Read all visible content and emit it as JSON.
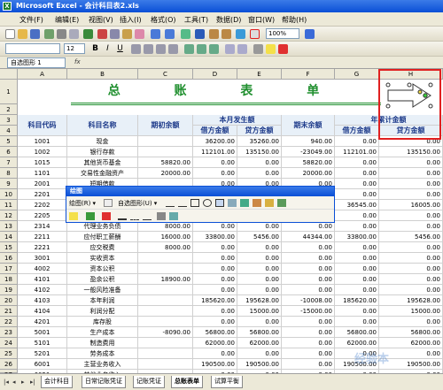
{
  "window": {
    "title": "Microsoft Excel - 会计科目表2.xls",
    "app_icon": "X"
  },
  "menu": [
    "文件(F)",
    "编辑(E)",
    "视图(V)",
    "插入(I)",
    "格式(O)",
    "工具(T)",
    "数据(D)",
    "窗口(W)",
    "帮助(H)"
  ],
  "toolbar": {
    "zoom": "100%",
    "font_size": "12"
  },
  "namebox": {
    "value": "自选图形 1",
    "fx": "fx"
  },
  "columns": [
    "A",
    "B",
    "C",
    "D",
    "E",
    "F",
    "G",
    "H"
  ],
  "rows": [
    "1",
    "2",
    "3",
    "4",
    "5",
    "6",
    "7",
    "8",
    "9",
    "10",
    "11",
    "12",
    "13",
    "14",
    "15",
    "16",
    "17",
    "18",
    "19",
    "20",
    "21",
    "22",
    "23",
    "24",
    "25",
    "26",
    "27"
  ],
  "sheet": {
    "title": "总 账 表 单",
    "headers": {
      "code": "科目代码",
      "name": "科目名称",
      "opening": "期初余额",
      "current_period": "本月发生额",
      "debit": "借方金额",
      "credit": "贷方金额",
      "closing": "期末余额",
      "ytd": "年累计金额",
      "ytd_debit": "借方金额",
      "ytd_credit": "贷方金额"
    },
    "data": [
      [
        "1001",
        "现金",
        "",
        "36200.00",
        "35260.00",
        "940.00",
        "0.00",
        "0.00"
      ],
      [
        "1002",
        "银行存款",
        "",
        "112101.00",
        "135150.00",
        "-23049.00",
        "112101.00",
        "135150.00"
      ],
      [
        "1015",
        "其他货币基金",
        "58820.00",
        "0.00",
        "0.00",
        "58820.00",
        "0.00",
        "0.00"
      ],
      [
        "1101",
        "交易性金融资产",
        "20000.00",
        "0.00",
        "0.00",
        "20000.00",
        "0.00",
        "0.00"
      ],
      [
        "2001",
        "短期借款",
        "",
        "0.00",
        "0.00",
        "0.00",
        "0.00",
        "0.00"
      ],
      [
        "2201",
        "应付票据",
        "",
        "0.00",
        "0.00",
        "0.00",
        "0.00",
        "0.00"
      ],
      [
        "2202",
        "应付账款",
        "",
        "0.00",
        "0.00",
        "0.00",
        "36545.00",
        "16005.00"
      ],
      [
        "2205",
        "预收账款",
        "",
        "0.00",
        "0.00",
        "0.00",
        "0.00",
        "0.00"
      ],
      [
        "2314",
        "代理业务负债",
        "8000.00",
        "0.00",
        "0.00",
        "0.00",
        "0.00",
        "0.00"
      ],
      [
        "2211",
        "应付职工薪酬",
        "16000.00",
        "33800.00",
        "5456.00",
        "44344.00",
        "33800.00",
        "5456.00"
      ],
      [
        "2221",
        "应交税费",
        "8000.00",
        "0.00",
        "0.00",
        "0.00",
        "0.00",
        "0.00"
      ],
      [
        "3001",
        "实收资本",
        "",
        "0.00",
        "0.00",
        "0.00",
        "0.00",
        "0.00"
      ],
      [
        "4002",
        "资本公积",
        "",
        "0.00",
        "0.00",
        "0.00",
        "0.00",
        "0.00"
      ],
      [
        "4101",
        "盈余公积",
        "18900.00",
        "0.00",
        "0.00",
        "0.00",
        "0.00",
        "0.00"
      ],
      [
        "4102",
        "一般风险准备",
        "",
        "0.00",
        "0.00",
        "0.00",
        "0.00",
        "0.00"
      ],
      [
        "4103",
        "本年利润",
        "",
        "185620.00",
        "195628.00",
        "-10008.00",
        "185620.00",
        "195628.00"
      ],
      [
        "4104",
        "利润分配",
        "",
        "0.00",
        "15000.00",
        "-15000.00",
        "0.00",
        "15000.00"
      ],
      [
        "4201",
        "库存股",
        "",
        "0.00",
        "0.00",
        "0.00",
        "0.00",
        "0.00"
      ],
      [
        "5001",
        "生产成本",
        "-8090.00",
        "56800.00",
        "56800.00",
        "0.00",
        "56800.00",
        "56800.00"
      ],
      [
        "5101",
        "制造费用",
        "",
        "62000.00",
        "62000.00",
        "0.00",
        "62000.00",
        "62000.00"
      ],
      [
        "5201",
        "劳务成本",
        "",
        "0.00",
        "0.00",
        "0.00",
        "0.00",
        "0.00"
      ],
      [
        "6001",
        "主营业务收入",
        "",
        "190500.00",
        "190500.00",
        "0.00",
        "190500.00",
        "190500.00"
      ],
      [
        "6051",
        "其他业务收入",
        "",
        "0.00",
        "0.00",
        "0.00",
        "0.00",
        "0.00"
      ]
    ]
  },
  "drawing_toolbar": {
    "title": "绘图",
    "draw_label": "绘图(R) ▾",
    "autoshapes_label": "自选图形(U) ▾"
  },
  "tabs": [
    "会计科目",
    "日常记账凭证",
    "记账凭证",
    "总账表单",
    "试算平衡"
  ],
  "active_tab": "总账表单",
  "watermark": "经验本"
}
